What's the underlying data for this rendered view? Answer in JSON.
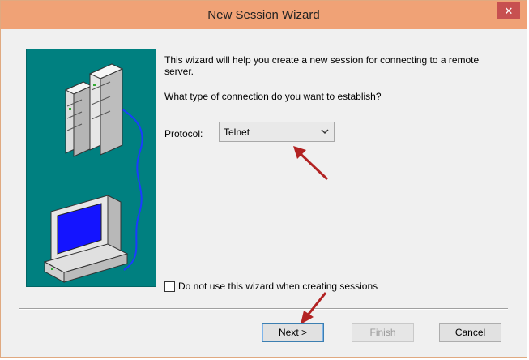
{
  "window": {
    "title": "New Session Wizard",
    "close_label": "✕"
  },
  "intro_text": "This wizard will help you create a new session for connecting to a remote server.",
  "question_text": "What type of connection do you want to establish?",
  "protocol": {
    "label": "Protocol:",
    "selected": "Telnet"
  },
  "checkbox": {
    "label": "Do not use this wizard when creating sessions",
    "checked": false
  },
  "buttons": {
    "next": "Next >",
    "finish": "Finish",
    "cancel": "Cancel"
  },
  "colors": {
    "title_bar": "#f0a276",
    "banner": "#008080",
    "close_button": "#c75050",
    "annotation_arrow": "#b22222"
  },
  "icons": [
    "close-icon",
    "server-icon",
    "computer-icon",
    "chevron-down-icon",
    "arrow-annotation"
  ]
}
